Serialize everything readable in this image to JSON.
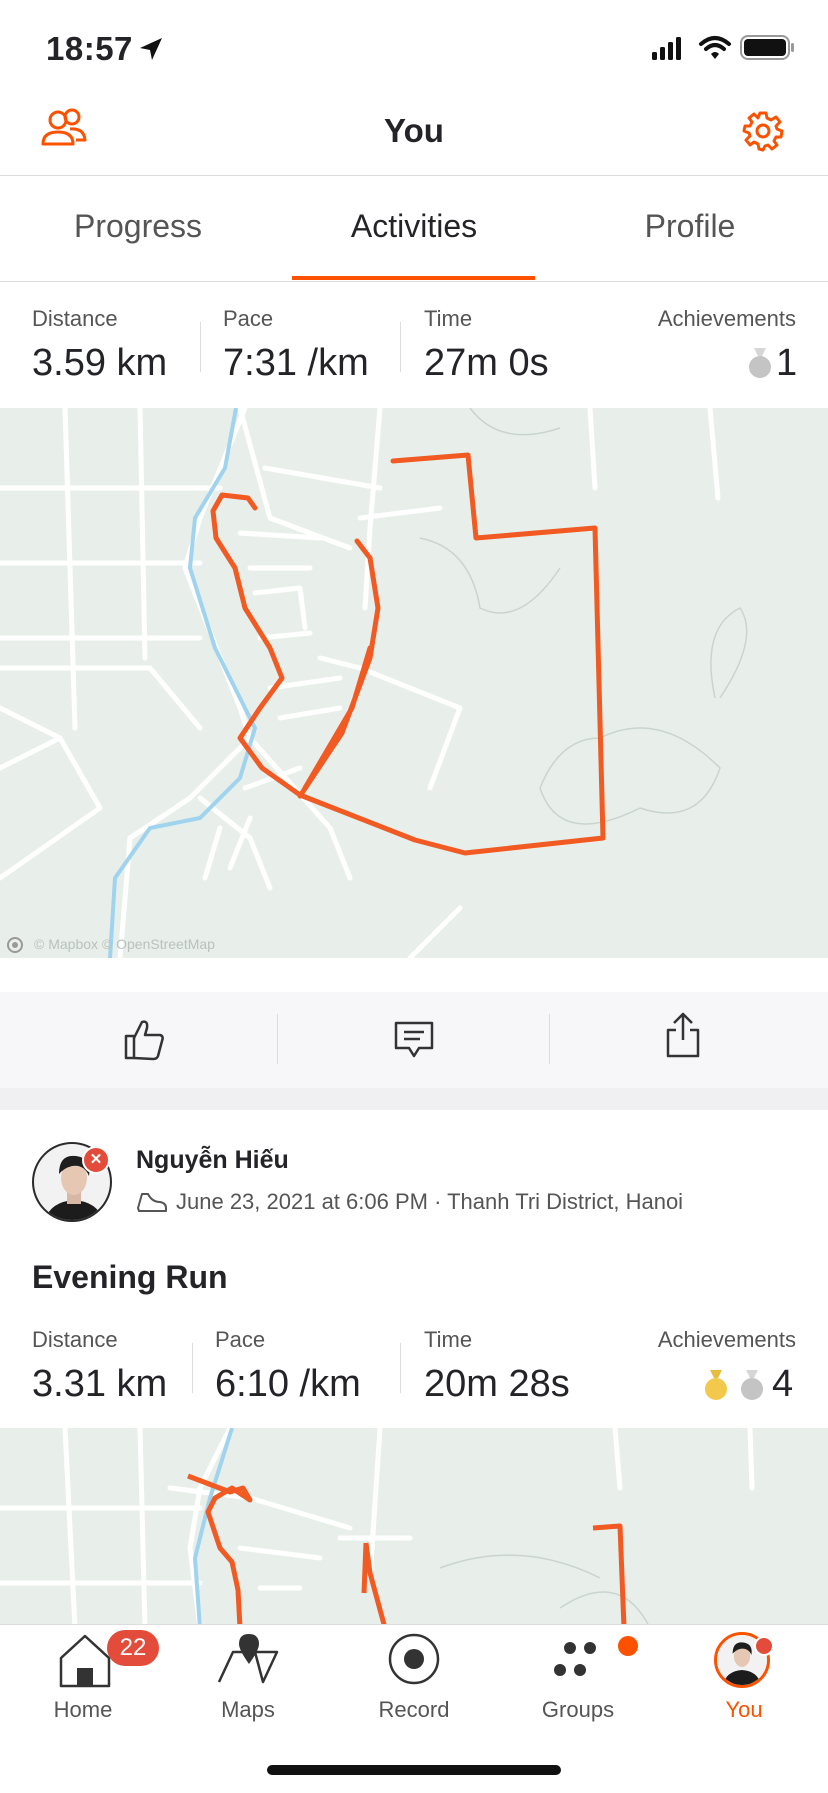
{
  "status_bar": {
    "time": "18:57"
  },
  "header": {
    "title": "You"
  },
  "tabs": [
    {
      "label": "Progress"
    },
    {
      "label": "Activities"
    },
    {
      "label": "Profile"
    }
  ],
  "activity1": {
    "stats": {
      "distance_label": "Distance",
      "distance": "3.59 km",
      "pace_label": "Pace",
      "pace": "7:31 /km",
      "time_label": "Time",
      "time": "27m 0s",
      "achievements_label": "Achievements",
      "achievements": "1"
    },
    "map_attribution": "© Mapbox © OpenStreetMap"
  },
  "activity2": {
    "athlete": "Nguyễn Hiếu",
    "meta": "June 23, 2021 at 6:06 PM · Thanh Tri District, Hanoi",
    "title": "Evening Run",
    "stats": {
      "distance_label": "Distance",
      "distance": "3.31 km",
      "pace_label": "Pace",
      "pace": "6:10 /km",
      "time_label": "Time",
      "time": "20m 28s",
      "achievements_label": "Achievements",
      "achievements": "4"
    }
  },
  "tabbar": {
    "home": "Home",
    "home_badge": "22",
    "maps": "Maps",
    "record": "Record",
    "groups": "Groups",
    "you": "You"
  },
  "colors": {
    "accent": "#fc5200",
    "route": "#f15a22",
    "map_bg": "#e8efea",
    "water": "#9fd3ee",
    "gold": "#f2c94c",
    "silver": "#c4c4c4"
  },
  "icons": [
    "navigation-arrow-icon",
    "signal-icon",
    "wifi-icon",
    "battery-icon",
    "friends-icon",
    "gear-icon",
    "thumbs-up-icon",
    "comment-icon",
    "share-icon",
    "shoe-icon",
    "home-icon",
    "map-icon",
    "record-icon",
    "groups-icon",
    "profile-avatar-icon"
  ]
}
